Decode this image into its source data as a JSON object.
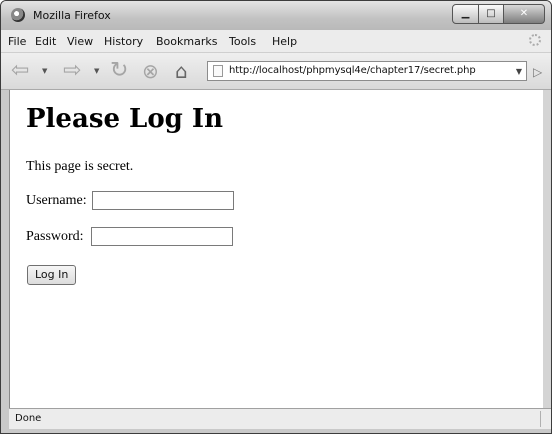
{
  "window": {
    "title": "Mozilla Firefox"
  },
  "menubar": {
    "items": [
      {
        "label": "File"
      },
      {
        "label": "Edit"
      },
      {
        "label": "View"
      },
      {
        "label": "History"
      },
      {
        "label": "Bookmarks"
      },
      {
        "label": "Tools"
      },
      {
        "label": "Help"
      }
    ]
  },
  "navbar": {
    "url": "http://localhost/phpmysql4e/chapter17/secret.php"
  },
  "page": {
    "heading": "Please Log In",
    "intro": "This page is secret.",
    "username_label": "Username:",
    "username_value": "",
    "password_label": "Password:",
    "password_value": "",
    "submit_label": "Log In"
  },
  "statusbar": {
    "text": "Done"
  }
}
